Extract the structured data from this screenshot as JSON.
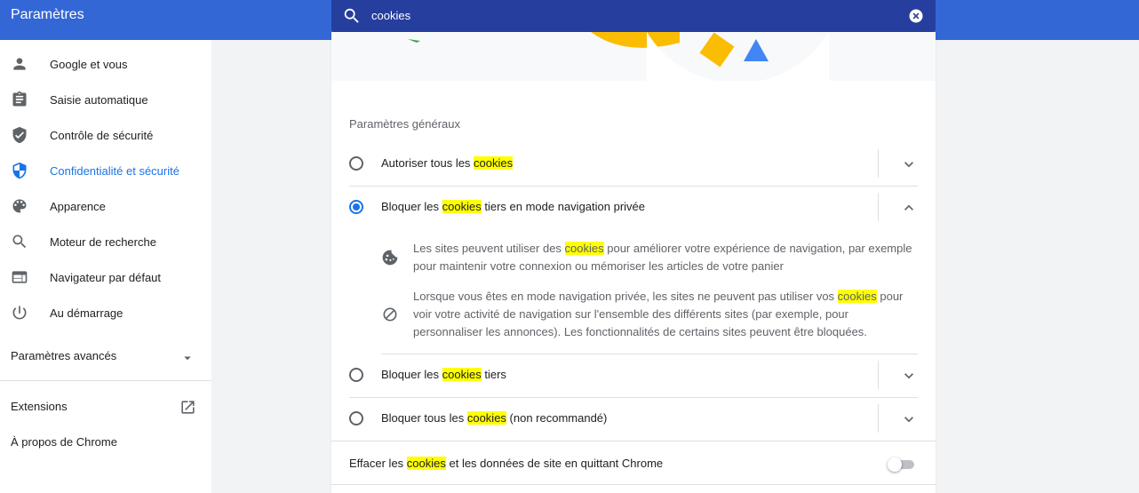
{
  "app": {
    "title": "Paramètres"
  },
  "search": {
    "value": "cookies"
  },
  "sidebar": {
    "items": [
      {
        "label": "Google et vous",
        "icon": "person-icon"
      },
      {
        "label": "Saisie automatique",
        "icon": "clipboard-icon"
      },
      {
        "label": "Contrôle de sécurité",
        "icon": "shield-check-icon"
      },
      {
        "label": "Confidentialité et sécurité",
        "icon": "shield-icon",
        "active": true
      },
      {
        "label": "Apparence",
        "icon": "palette-icon"
      },
      {
        "label": "Moteur de recherche",
        "icon": "search-icon"
      },
      {
        "label": "Navigateur par défaut",
        "icon": "browser-icon"
      },
      {
        "label": "Au démarrage",
        "icon": "power-icon"
      }
    ],
    "advanced": "Paramètres avancés",
    "extensions": "Extensions",
    "about": "À propos de Chrome"
  },
  "main": {
    "section_title": "Paramètres généraux",
    "highlight_term": "cookies",
    "options": [
      {
        "pre": "Autoriser tous les ",
        "term": "cookies",
        "post": "",
        "checked": false,
        "expanded": false
      },
      {
        "pre": "Bloquer les ",
        "term": "cookies",
        "post": " tiers en mode navigation privée",
        "checked": true,
        "expanded": true
      },
      {
        "pre": "Bloquer les ",
        "term": "cookies",
        "post": " tiers",
        "checked": false,
        "expanded": false
      },
      {
        "pre": "Bloquer tous les ",
        "term": "cookies",
        "post": " (non recommandé)",
        "checked": false,
        "expanded": false
      }
    ],
    "details": [
      {
        "icon": "cookie-icon",
        "pre": "Les sites peuvent utiliser des ",
        "term": "cookies",
        "post": " pour améliorer votre expérience de navigation, par exemple pour maintenir votre connexion ou mémoriser les articles de votre panier"
      },
      {
        "icon": "block-icon",
        "pre": "Lorsque vous êtes en mode navigation privée, les sites ne peuvent pas utiliser vos ",
        "term": "cookies",
        "post": " pour voir votre activité de navigation sur l'ensemble des différents sites (par exemple, pour personnaliser les annonces). Les fonctionnalités de certains sites peuvent être bloquées."
      }
    ],
    "clear_on_exit": {
      "pre": "Effacer les ",
      "term": "cookies",
      "post": " et les données de site en quittant Chrome",
      "enabled": false
    }
  },
  "colors": {
    "header": "#3367d6",
    "search_bg": "#263e9e",
    "accent": "#1a73e8",
    "highlight": "#ffff00"
  }
}
